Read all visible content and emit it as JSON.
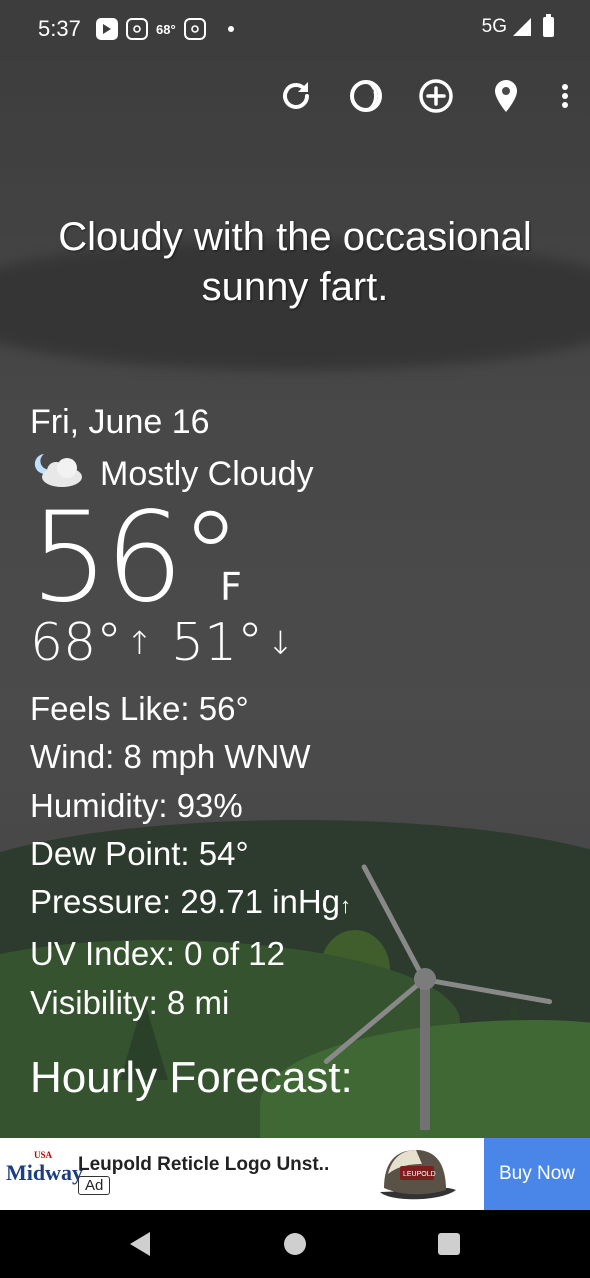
{
  "status_bar": {
    "time": "5:37",
    "notif_temp": "68°",
    "network": "5G"
  },
  "toolbar": {
    "icons": [
      "refresh-icon",
      "theme-icon",
      "add-icon",
      "location-icon",
      "more-icon"
    ]
  },
  "tagline": "Cloudy with the occasional sunny fart.",
  "weather": {
    "date": "Fri, June 16",
    "condition": "Mostly Cloudy",
    "temperature": "56°",
    "unit": "F",
    "high": "68°",
    "low": "51°",
    "details": {
      "feels_like": "Feels Like:  56°",
      "wind": "Wind:  8 mph WNW",
      "humidity": "Humidity:  93%",
      "dew_point": "Dew Point:  54°",
      "pressure": "Pressure:  29.71 inHg",
      "pressure_trend": "↑",
      "uv_index": "UV Index:  0 of 12",
      "visibility": "Visibility:  8 mi"
    },
    "hourly_heading": "Hourly Forecast:"
  },
  "ad": {
    "brand": "Midway",
    "brand_tag": "USA",
    "title": "Leupold Reticle Logo Unst..",
    "tag": "Ad",
    "hat_text": "LEUPOLD",
    "cta": "Buy Now",
    "accent": "#4a86e8"
  }
}
